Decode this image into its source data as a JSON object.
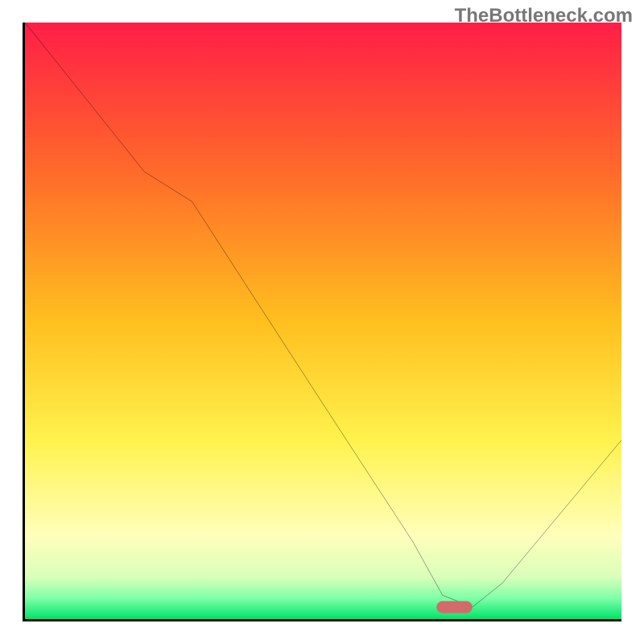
{
  "watermark": "TheBottleneck.com",
  "chart_data": {
    "type": "line",
    "title": "",
    "xlabel": "",
    "ylabel": "",
    "xlim": [
      0,
      100
    ],
    "ylim": [
      0,
      100
    ],
    "x": [
      0,
      8,
      20,
      28,
      50,
      65,
      70,
      75,
      80,
      100
    ],
    "values": [
      100,
      90,
      75,
      70,
      36,
      13,
      4,
      2,
      6,
      30
    ],
    "marker": {
      "x": 72,
      "y": 2,
      "width": 6,
      "height": 2,
      "color": "#d46a6a"
    },
    "gradient_stops": [
      {
        "offset": 0.0,
        "color": "#ff1e47"
      },
      {
        "offset": 0.25,
        "color": "#ff6a2a"
      },
      {
        "offset": 0.5,
        "color": "#ffbf1f"
      },
      {
        "offset": 0.7,
        "color": "#fff24d"
      },
      {
        "offset": 0.86,
        "color": "#ffffbb"
      },
      {
        "offset": 0.93,
        "color": "#d9ffba"
      },
      {
        "offset": 0.965,
        "color": "#7fffa8"
      },
      {
        "offset": 1.0,
        "color": "#00e36a"
      }
    ]
  }
}
